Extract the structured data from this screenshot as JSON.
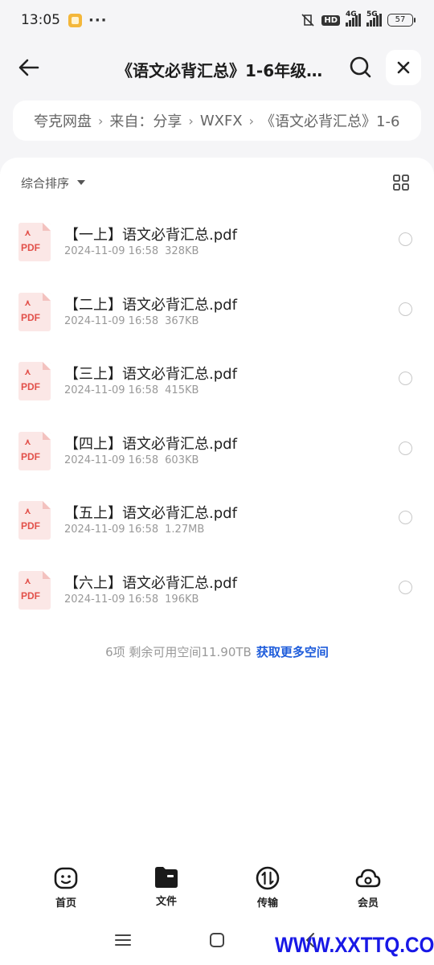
{
  "status_bar": {
    "time": "13:05",
    "dots": "···",
    "hd": "HD",
    "net1": "4G",
    "net2": "5G",
    "battery": "57"
  },
  "header": {
    "title": "《语文必背汇总》1-6年级…",
    "back_icon": "arrow-left-icon",
    "search_icon": "search-icon",
    "close_icon": "close-icon"
  },
  "breadcrumb": {
    "items": [
      "夸克网盘",
      "来自：分享",
      "WXFX",
      "《语文必背汇总》1-6"
    ],
    "separator": "›"
  },
  "toolbar": {
    "sort_label": "综合排序",
    "grid_icon": "grid-view-icon"
  },
  "files": [
    {
      "name": "【一上】语文必背汇总.pdf",
      "date": "2024-11-09 16:58",
      "size": "328KB"
    },
    {
      "name": "【二上】语文必背汇总.pdf",
      "date": "2024-11-09 16:58",
      "size": "367KB"
    },
    {
      "name": "【三上】语文必背汇总.pdf",
      "date": "2024-11-09 16:58",
      "size": "415KB"
    },
    {
      "name": "【四上】语文必背汇总.pdf",
      "date": "2024-11-09 16:58",
      "size": "603KB"
    },
    {
      "name": "【五上】语文必背汇总.pdf",
      "date": "2024-11-09 16:58",
      "size": "1.27MB"
    },
    {
      "name": "【六上】语文必背汇总.pdf",
      "date": "2024-11-09 16:58",
      "size": "196KB"
    }
  ],
  "pdf_tag": "PDF",
  "summary": {
    "text": "6项 剩余可用空间11.90TB",
    "link": "获取更多空间"
  },
  "bottom_nav": {
    "items": [
      {
        "label": "首页",
        "icon": "home-icon"
      },
      {
        "label": "文件",
        "icon": "folder-icon"
      },
      {
        "label": "传输",
        "icon": "transfer-icon"
      },
      {
        "label": "会员",
        "icon": "cloud-icon"
      }
    ]
  },
  "watermark": "WWW.XXTTQ.COM",
  "colors": {
    "accent": "#1f5ddb",
    "pdf_red": "#e2504a",
    "background": "#f5f5f7"
  }
}
